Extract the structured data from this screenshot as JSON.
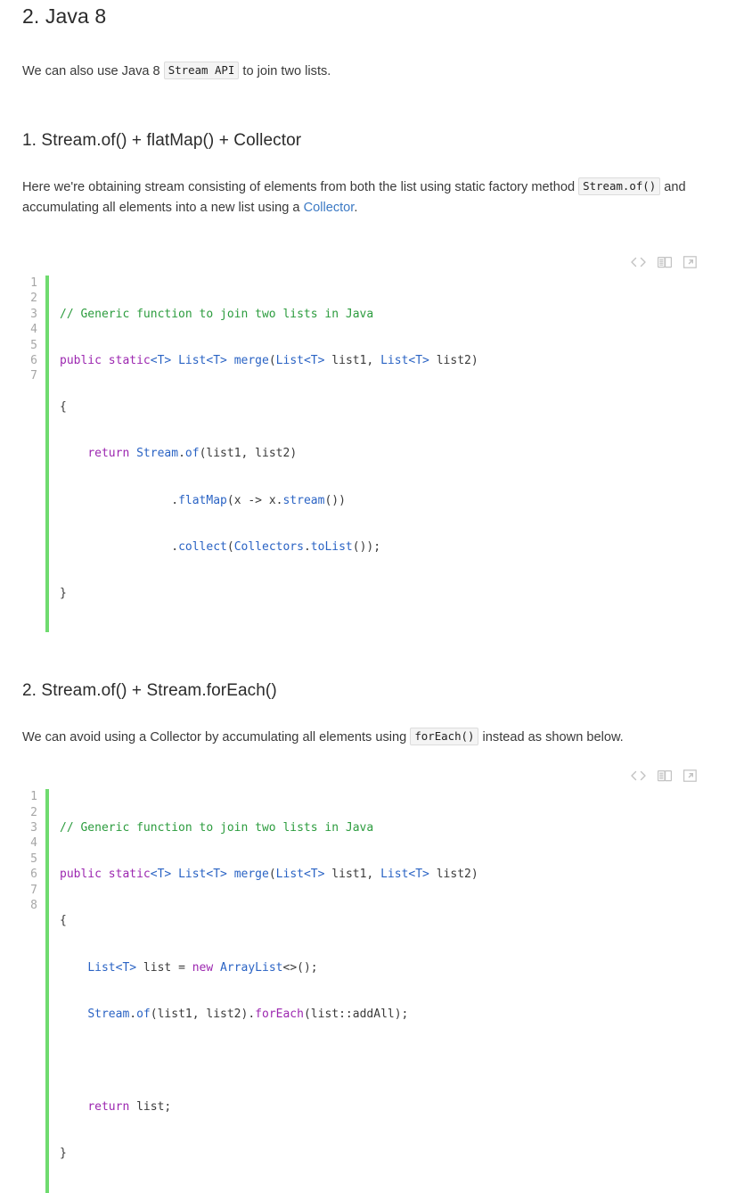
{
  "sections": {
    "java8": {
      "heading": "2. Java 8",
      "intro_before": "We can also use Java 8 ",
      "intro_code": "Stream API",
      "intro_after": " to join two lists."
    },
    "sub1": {
      "heading": "1. Stream.of() + flatMap() + Collector",
      "para_1": "Here we're obtaining stream consisting of elements from both the list using static factory method ",
      "para_code": "Stream.of()",
      "para_2": " and accumulating all elements into a new list using a ",
      "para_link": "Collector",
      "para_3": "."
    },
    "sub2": {
      "heading": "2. Stream.of() + Stream.forEach()",
      "para_1": "We can avoid using a Collector by accumulating all elements using ",
      "para_code": "forEach()",
      "para_2": " instead as shown below."
    }
  },
  "toolbar": {
    "code_view_title": "View source",
    "copy_title": "Copy code",
    "expand_title": "Open in new window"
  },
  "code_block_1": {
    "line_numbers": [
      "1",
      "2",
      "3",
      "4",
      "5",
      "6",
      "7"
    ],
    "lines": [
      "// Generic function to join two lists in Java",
      "public static<T> List<T> merge(List<T> list1, List<T> list2)",
      "{",
      "    return Stream.of(list1, list2)",
      "                .flatMap(x -> x.stream())",
      "                .collect(Collectors.toList());",
      "}"
    ]
  },
  "code_block_2": {
    "line_numbers": [
      "1",
      "2",
      "3",
      "4",
      "5",
      "6",
      "7",
      "8"
    ],
    "lines": [
      "// Generic function to join two lists in Java",
      "public static<T> List<T> merge(List<T> list1, List<T> list2)",
      "{",
      "    List<T> list = new ArrayList<>();",
      "    Stream.of(list1, list2).forEach(list::addAll);",
      "",
      "    return list;",
      "}"
    ]
  },
  "colors": {
    "comment": "#2c9c3e",
    "keyword": "#9c27b0",
    "type": "#2a63c4",
    "link": "#3b79c4",
    "gutter_bar": "#6fdb6f",
    "line_number": "#a6a6a6",
    "icon": "#c2c2c2"
  }
}
